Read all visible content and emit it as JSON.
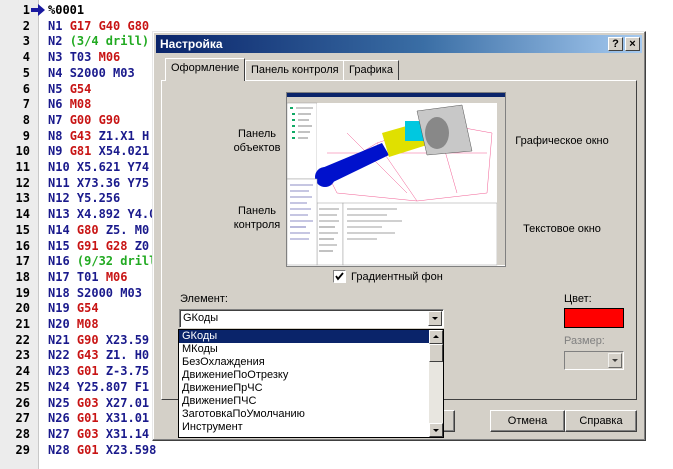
{
  "editor": {
    "lines": [
      {
        "num": "1",
        "tokens": [
          {
            "t": "%0001",
            "c": "cK"
          }
        ],
        "current": true
      },
      {
        "num": "2",
        "tokens": [
          {
            "t": "N1 ",
            "c": "cN"
          },
          {
            "t": "G17 G40 G80",
            "c": "cG"
          }
        ]
      },
      {
        "num": "3",
        "tokens": [
          {
            "t": "N2 ",
            "c": "cN"
          },
          {
            "t": "(3/4 drill)",
            "c": "cC"
          }
        ]
      },
      {
        "num": "4",
        "tokens": [
          {
            "t": "N3 ",
            "c": "cN"
          },
          {
            "t": "T03 ",
            "c": "cT"
          },
          {
            "t": "M06",
            "c": "cG"
          }
        ]
      },
      {
        "num": "5",
        "tokens": [
          {
            "t": "N4 ",
            "c": "cN"
          },
          {
            "t": "S2000 ",
            "c": "cX"
          },
          {
            "t": "M03",
            "c": "cM"
          }
        ]
      },
      {
        "num": "6",
        "tokens": [
          {
            "t": "N5 ",
            "c": "cN"
          },
          {
            "t": "G54",
            "c": "cG"
          }
        ]
      },
      {
        "num": "7",
        "tokens": [
          {
            "t": "N6 ",
            "c": "cN"
          },
          {
            "t": "M08",
            "c": "cG"
          }
        ]
      },
      {
        "num": "8",
        "tokens": [
          {
            "t": "N7 ",
            "c": "cN"
          },
          {
            "t": "G00 G90",
            "c": "cG"
          }
        ]
      },
      {
        "num": "9",
        "tokens": [
          {
            "t": "N8 ",
            "c": "cN"
          },
          {
            "t": "G43 ",
            "c": "cG"
          },
          {
            "t": "Z1.X1 H",
            "c": "cX"
          }
        ]
      },
      {
        "num": "10",
        "tokens": [
          {
            "t": "N9 ",
            "c": "cN"
          },
          {
            "t": "G81 ",
            "c": "cG"
          },
          {
            "t": "X54.021",
            "c": "cX"
          }
        ]
      },
      {
        "num": "11",
        "tokens": [
          {
            "t": "N10 ",
            "c": "cN"
          },
          {
            "t": "X5.621 Y74",
            "c": "cX"
          }
        ]
      },
      {
        "num": "12",
        "tokens": [
          {
            "t": "N11 ",
            "c": "cN"
          },
          {
            "t": "X73.36 Y75",
            "c": "cX"
          }
        ]
      },
      {
        "num": "13",
        "tokens": [
          {
            "t": "N12 ",
            "c": "cN"
          },
          {
            "t": "Y5.256",
            "c": "cX"
          }
        ]
      },
      {
        "num": "14",
        "tokens": [
          {
            "t": "N13 ",
            "c": "cN"
          },
          {
            "t": "X4.892 Y4.0",
            "c": "cX"
          }
        ]
      },
      {
        "num": "15",
        "tokens": [
          {
            "t": "N14 ",
            "c": "cN"
          },
          {
            "t": "G80 ",
            "c": "cG"
          },
          {
            "t": "Z5. ",
            "c": "cX"
          },
          {
            "t": "M0",
            "c": "cM"
          }
        ]
      },
      {
        "num": "16",
        "tokens": [
          {
            "t": "N15 ",
            "c": "cN"
          },
          {
            "t": "G91 G28 ",
            "c": "cG"
          },
          {
            "t": "Z0",
            "c": "cX"
          }
        ]
      },
      {
        "num": "17",
        "tokens": [
          {
            "t": "N16 ",
            "c": "cN"
          },
          {
            "t": "(9/32 drill)",
            "c": "cC"
          }
        ]
      },
      {
        "num": "18",
        "tokens": [
          {
            "t": "N17 ",
            "c": "cN"
          },
          {
            "t": "T01 ",
            "c": "cT"
          },
          {
            "t": "M06",
            "c": "cG"
          }
        ]
      },
      {
        "num": "19",
        "tokens": [
          {
            "t": "N18 ",
            "c": "cN"
          },
          {
            "t": "S2000 ",
            "c": "cX"
          },
          {
            "t": "M03",
            "c": "cM"
          }
        ]
      },
      {
        "num": "20",
        "tokens": [
          {
            "t": "N19 ",
            "c": "cN"
          },
          {
            "t": "G54",
            "c": "cG"
          }
        ]
      },
      {
        "num": "21",
        "tokens": [
          {
            "t": "N20 ",
            "c": "cN"
          },
          {
            "t": "M08",
            "c": "cG"
          }
        ]
      },
      {
        "num": "22",
        "tokens": [
          {
            "t": "N21 ",
            "c": "cN"
          },
          {
            "t": "G90 ",
            "c": "cG"
          },
          {
            "t": "X23.59",
            "c": "cX"
          }
        ]
      },
      {
        "num": "23",
        "tokens": [
          {
            "t": "N22 ",
            "c": "cN"
          },
          {
            "t": "G43 ",
            "c": "cG"
          },
          {
            "t": "Z1. H0",
            "c": "cX"
          }
        ]
      },
      {
        "num": "24",
        "tokens": [
          {
            "t": "N23 ",
            "c": "cN"
          },
          {
            "t": "G01 ",
            "c": "cG"
          },
          {
            "t": "Z-3.75",
            "c": "cX"
          }
        ]
      },
      {
        "num": "25",
        "tokens": [
          {
            "t": "N24 ",
            "c": "cN"
          },
          {
            "t": "Y25.807 F1",
            "c": "cX"
          }
        ]
      },
      {
        "num": "26",
        "tokens": [
          {
            "t": "N25 ",
            "c": "cN"
          },
          {
            "t": "G03 ",
            "c": "cG"
          },
          {
            "t": "X27.01",
            "c": "cX"
          }
        ]
      },
      {
        "num": "27",
        "tokens": [
          {
            "t": "N26 ",
            "c": "cN"
          },
          {
            "t": "G01 ",
            "c": "cG"
          },
          {
            "t": "X31.01",
            "c": "cX"
          }
        ]
      },
      {
        "num": "28",
        "tokens": [
          {
            "t": "N27 ",
            "c": "cN"
          },
          {
            "t": "G03 ",
            "c": "cG"
          },
          {
            "t": "X31.14",
            "c": "cX"
          }
        ]
      },
      {
        "num": "29",
        "tokens": [
          {
            "t": "N28 ",
            "c": "cN"
          },
          {
            "t": "G01 ",
            "c": "cG"
          },
          {
            "t": "X23.598",
            "c": "cX"
          }
        ]
      }
    ]
  },
  "dialog": {
    "title": "Настройка",
    "help_btn": "?",
    "close_btn": "×",
    "tabs": [
      "Оформление",
      "Панель контроля",
      "Графика"
    ],
    "labels": {
      "objects_panel": "Панель объектов",
      "control_panel": "Панель контроля",
      "graphic_window": "Графическое окно",
      "text_window": "Текстовое окно"
    },
    "gradient_checkbox": {
      "label": "Градиентный фон",
      "checked": true
    },
    "element_label": "Элемент:",
    "element_value": "GКоды",
    "element_options": [
      "GКоды",
      "MКоды",
      "БезОхлаждения",
      "ДвижениеПоОтрезку",
      "ДвижениеПрЧС",
      "ДвижениеПЧС",
      "ЗаготовкаПоУмолчанию",
      "Инструмент"
    ],
    "color_label": "Цвет:",
    "color_value": "#ff0000",
    "size_label": "Размер:",
    "buttons": {
      "cancel": "Отмена",
      "help": "Справка"
    }
  }
}
